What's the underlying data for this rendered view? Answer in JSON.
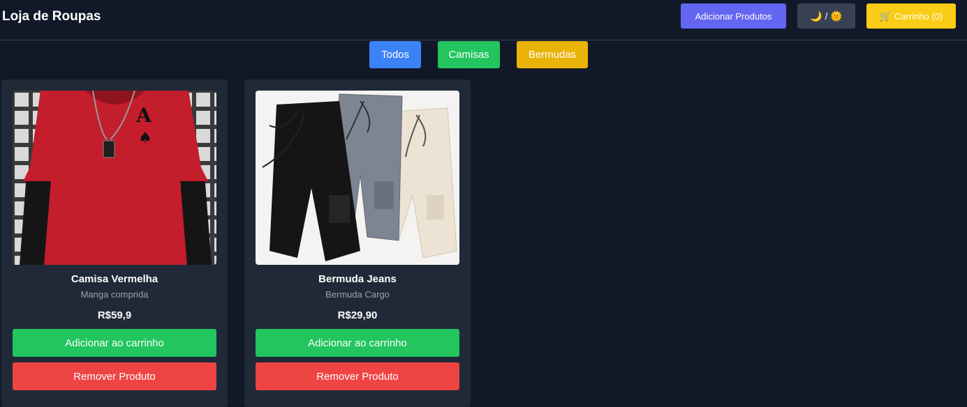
{
  "header": {
    "title": "Loja de Roupas",
    "add_products_label": "Adicionar Produtos",
    "theme_toggle_label": "🌙 / 🌞",
    "cart_icon": "cart-icon",
    "cart_label": "Carrinho (0)"
  },
  "filters": {
    "all": "Todos",
    "shirts": "Camisas",
    "shorts": "Bermudas"
  },
  "products": [
    {
      "name": "Camisa Vermelha",
      "description": "Manga comprida",
      "price": "R$59,9",
      "add_label": "Adicionar ao carrinho",
      "remove_label": "Remover Produto"
    },
    {
      "name": "Bermuda Jeans",
      "description": "Bermuda Cargo",
      "price": "R$29,90",
      "add_label": "Adicionar ao carrinho",
      "remove_label": "Remover Produto"
    }
  ],
  "colors": {
    "background": "#111827",
    "card": "#1f2937",
    "primary": "#6366f1",
    "blue": "#3b82f6",
    "green": "#22c55e",
    "yellow": "#eab308",
    "cart_yellow": "#facc15",
    "red": "#ef4444"
  }
}
